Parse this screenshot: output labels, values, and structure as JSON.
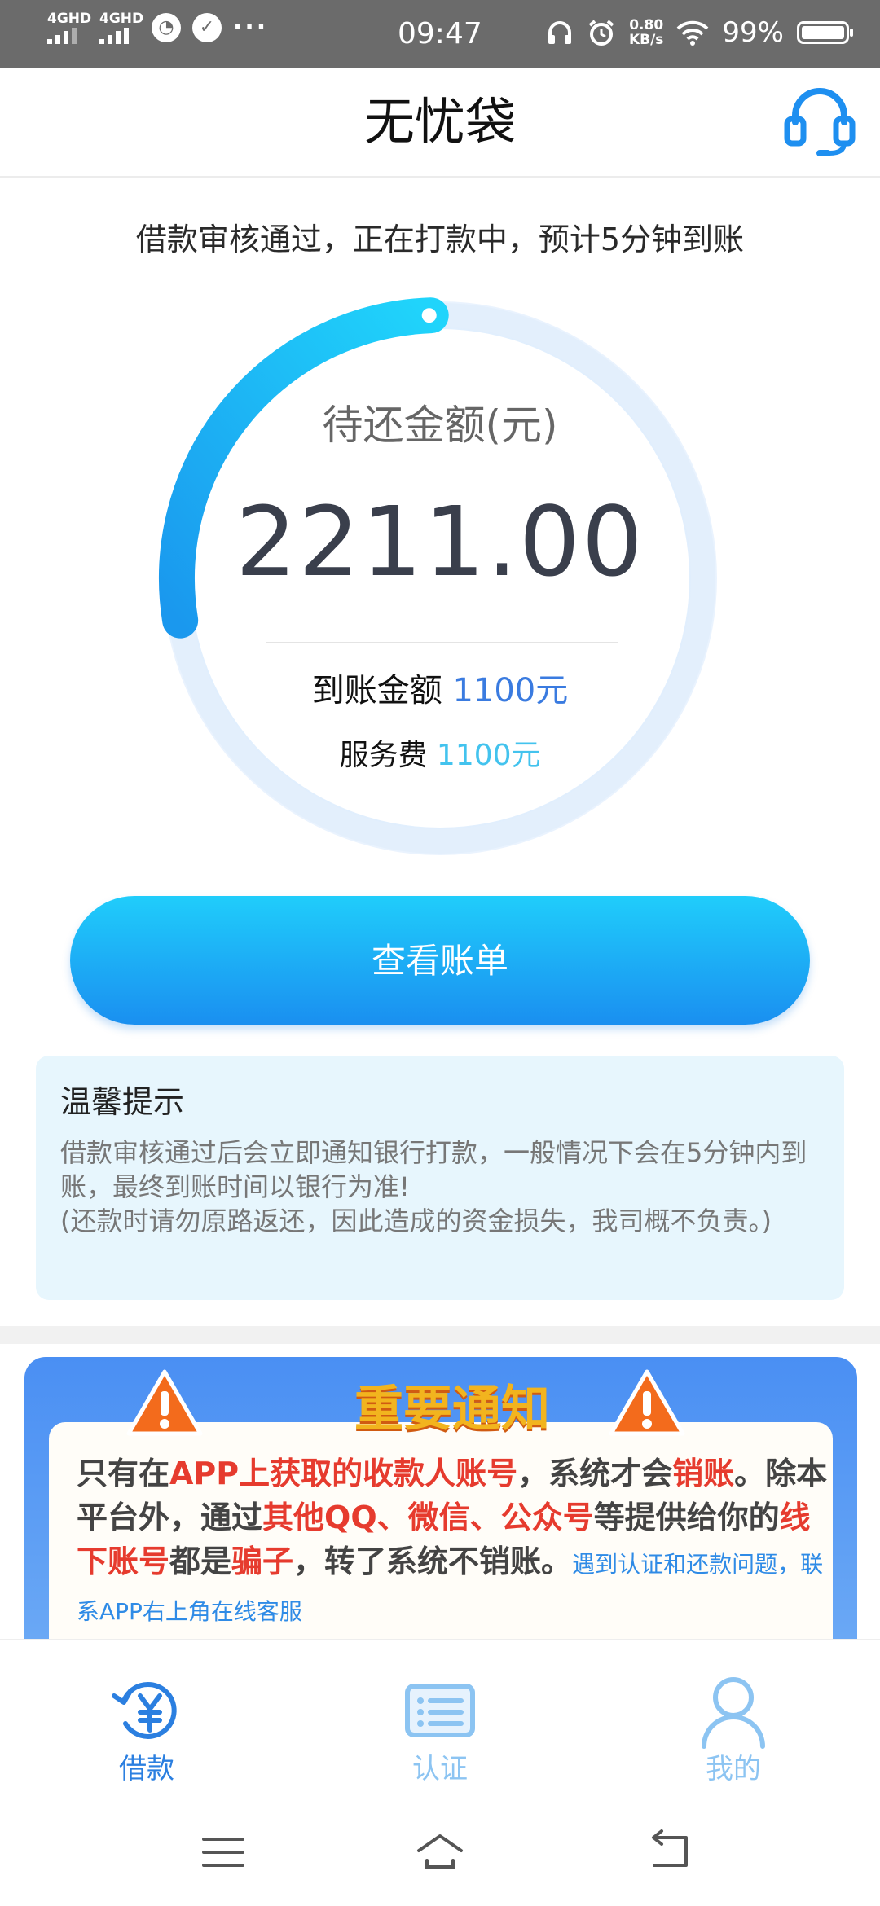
{
  "status_bar": {
    "signal1": "4GHD",
    "signal2": "4GHD",
    "icon_a": "check",
    "icon_b": "check",
    "more": "···",
    "time": "09:47",
    "speed_value": "0.80",
    "speed_unit": "KB/s",
    "battery": "99%"
  },
  "header": {
    "title": "无忧袋"
  },
  "status_message": "借款审核通过，正在打款中，预计5分钟到账",
  "progress": {
    "label": "待还金额(元)",
    "amount": "2211.00",
    "arc_fraction": 0.27
  },
  "details": {
    "received_label": "到账金额",
    "received_value": "1100元",
    "fee_label": "服务费",
    "fee_value": "1100元"
  },
  "view_bill_button": "查看账单",
  "tips": {
    "title": "温馨提示",
    "line1": "借款审核通过后会立即通知银行打款，一般情况下会在5分钟内到账，最终到账时间以银行为准!",
    "line2": "(还款时请勿原路返还，因此造成的资金损失，我司概不负责。)"
  },
  "notice": {
    "title": "重要通知",
    "seg1": "只有在",
    "seg2": "APP上获取的收款人账号",
    "seg3": "，系统才会",
    "seg4": "销账",
    "seg5": "。除本平台外，通过",
    "seg6": "其他QQ、微信、公众号",
    "seg7": "等提供给你的",
    "seg8": "线下账号",
    "seg9": "都是",
    "seg10": "骗子",
    "seg11": "，转了系统不销账。",
    "seg12": "遇到认证和还款问题，联系APP右上角在线客服"
  },
  "tabs": [
    {
      "label": "借款",
      "icon": "loan-icon",
      "active": true
    },
    {
      "label": "认证",
      "icon": "id-card-icon",
      "active": false
    },
    {
      "label": "我的",
      "icon": "person-icon",
      "active": false
    }
  ],
  "colors": {
    "accent": "#1a8ff0",
    "tab_active": "#2b7fe0",
    "tab_inactive": "#8cc4f2",
    "warning_red": "#e63b2e"
  }
}
